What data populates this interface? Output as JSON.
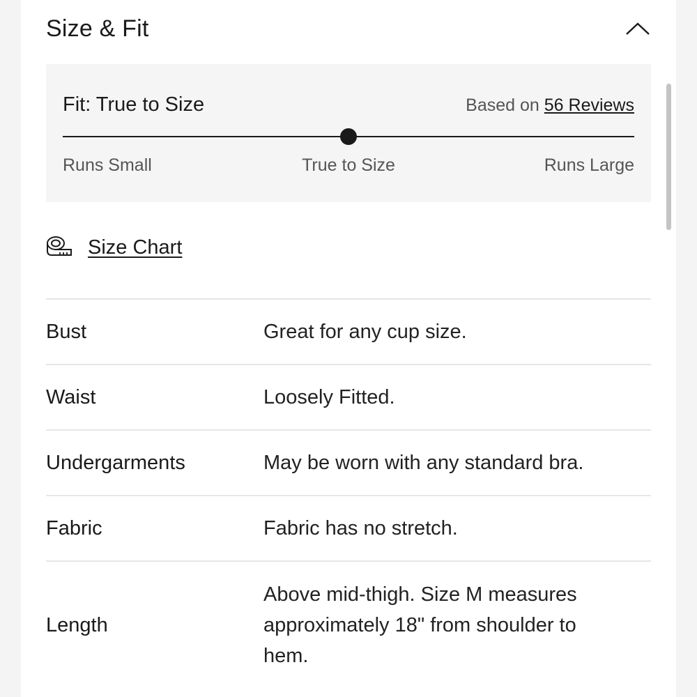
{
  "header": {
    "title": "Size & Fit",
    "collapse_icon": "chevron-up-icon"
  },
  "fit": {
    "title": "Fit: True to Size",
    "reviews_prefix": "Based on",
    "reviews_link": "56 Reviews",
    "scale": {
      "left": "Runs Small",
      "middle": "True to Size",
      "right": "Runs Large"
    },
    "indicator_position": 0.5
  },
  "size_chart": {
    "icon": "measuring-tape-icon",
    "label": "Size Chart"
  },
  "attributes": [
    {
      "name": "Bust",
      "value": "Great for any cup size."
    },
    {
      "name": "Waist",
      "value": "Loosely Fitted."
    },
    {
      "name": "Undergarments",
      "value": "May be worn with any standard bra."
    },
    {
      "name": "Fabric",
      "value": "Fabric has no stretch."
    },
    {
      "name": "Length",
      "value": "Above mid-thigh. Size M measures approximately 18\" from shoulder to hem."
    }
  ]
}
